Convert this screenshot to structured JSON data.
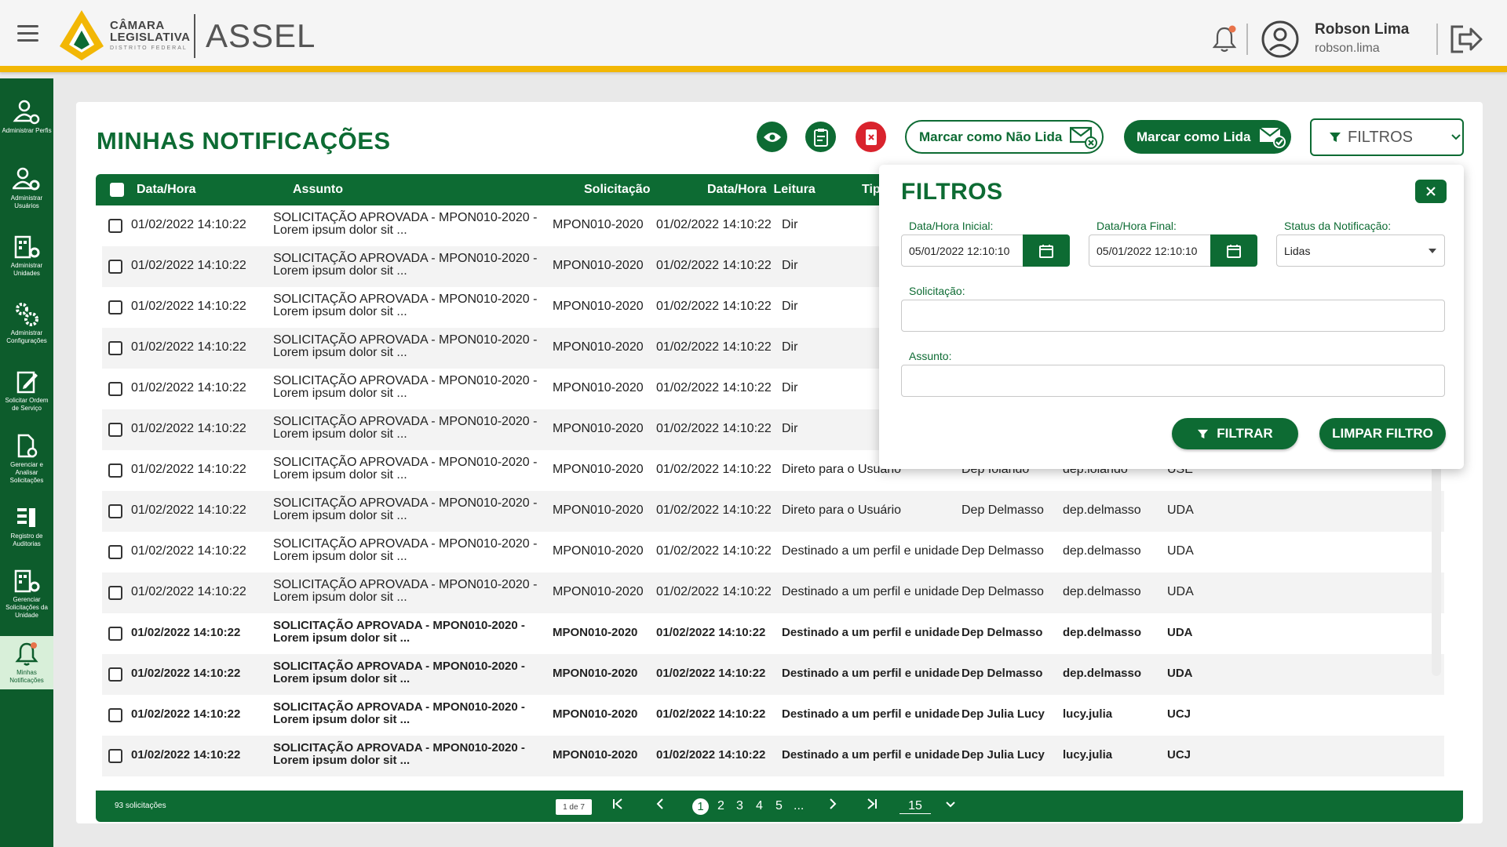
{
  "header": {
    "logo_line1": "CÂMARA",
    "logo_line2": "LEGISLATIVA",
    "logo_line3": "DISTRITO FEDERAL",
    "app_name": "ASSEL",
    "user_name": "Robson Lima",
    "user_login": "robson.lima"
  },
  "sidebar": {
    "items": [
      {
        "label": "Administrar Perfis",
        "icon": "user-gear-icon"
      },
      {
        "label": "Administrar Usuários",
        "icon": "users-gear-icon"
      },
      {
        "label": "Administrar Unidades",
        "icon": "building-gear-icon"
      },
      {
        "label": "Administrar Configurações",
        "icon": "gears-icon"
      },
      {
        "label": "Solicitar Ordem de Serviço",
        "icon": "edit-document-icon"
      },
      {
        "label": "Gerenciar e Analisar Solicitações",
        "icon": "document-view-icon"
      },
      {
        "label": "Registro de Auditorias",
        "icon": "audit-list-icon"
      },
      {
        "label": "Gerenciar Solicitações da Unidade",
        "icon": "building-gear-icon"
      },
      {
        "label": "Minhas Notificações",
        "icon": "bell-icon"
      }
    ]
  },
  "page": {
    "title": "MINHAS NOTIFICAÇÕES",
    "mark_unread": "Marcar como Não Lida",
    "mark_read": "Marcar como Lida",
    "filters_button": "FILTROS"
  },
  "table": {
    "headers": [
      "Data/Hora",
      "Assunto",
      "Solicitação",
      "Data/Hora  Leitura",
      "Tipo"
    ],
    "rows": [
      {
        "dt": "01/02/2022 14:10:22",
        "s1": "SOLICITAÇÃO APROVADA - MPON010-2020 -",
        "s2": "Lorem ipsum dolor sit ...",
        "sol": "MPON010-2020",
        "lt": "01/02/2022 14:10:22",
        "tipo": "Dir",
        "nome": "",
        "login": "",
        "un": ""
      },
      {
        "dt": "01/02/2022 14:10:22",
        "s1": "SOLICITAÇÃO APROVADA - MPON010-2020 -",
        "s2": "Lorem ipsum dolor sit ...",
        "sol": "MPON010-2020",
        "lt": "01/02/2022 14:10:22",
        "tipo": "Dir",
        "nome": "",
        "login": "",
        "un": ""
      },
      {
        "dt": "01/02/2022 14:10:22",
        "s1": "SOLICITAÇÃO APROVADA - MPON010-2020 -",
        "s2": "Lorem ipsum dolor sit ...",
        "sol": "MPON010-2020",
        "lt": "01/02/2022 14:10:22",
        "tipo": "Dir",
        "nome": "",
        "login": "",
        "un": ""
      },
      {
        "dt": "01/02/2022 14:10:22",
        "s1": "SOLICITAÇÃO APROVADA - MPON010-2020 -",
        "s2": "Lorem ipsum dolor sit ...",
        "sol": "MPON010-2020",
        "lt": "01/02/2022 14:10:22",
        "tipo": "Dir",
        "nome": "",
        "login": "",
        "un": ""
      },
      {
        "dt": "01/02/2022 14:10:22",
        "s1": "SOLICITAÇÃO APROVADA - MPON010-2020 -",
        "s2": "Lorem ipsum dolor sit ...",
        "sol": "MPON010-2020",
        "lt": "01/02/2022 14:10:22",
        "tipo": "Dir",
        "nome": "",
        "login": "",
        "un": ""
      },
      {
        "dt": "01/02/2022 14:10:22",
        "s1": "SOLICITAÇÃO APROVADA - MPON010-2020 -",
        "s2": "Lorem ipsum dolor sit ...",
        "sol": "MPON010-2020",
        "lt": "01/02/2022 14:10:22",
        "tipo": "Dir",
        "nome": "",
        "login": "",
        "un": ""
      },
      {
        "dt": "01/02/2022 14:10:22",
        "s1": "SOLICITAÇÃO APROVADA - MPON010-2020 -",
        "s2": "Lorem ipsum dolor sit ...",
        "sol": "MPON010-2020",
        "lt": "01/02/2022 14:10:22",
        "tipo": "Direto para o Usuário",
        "nome": "Dep Iolando",
        "login": "dep.iolando",
        "un": "USE"
      },
      {
        "dt": "01/02/2022 14:10:22",
        "s1": "SOLICITAÇÃO APROVADA - MPON010-2020 -",
        "s2": "Lorem ipsum dolor sit ...",
        "sol": "MPON010-2020",
        "lt": "01/02/2022 14:10:22",
        "tipo": "Direto para o Usuário",
        "nome": "Dep Delmasso",
        "login": "dep.delmasso",
        "un": "UDA"
      },
      {
        "dt": "01/02/2022 14:10:22",
        "s1": "SOLICITAÇÃO APROVADA - MPON010-2020 -",
        "s2": "Lorem ipsum dolor sit ...",
        "sol": "MPON010-2020",
        "lt": "01/02/2022 14:10:22",
        "tipo": "Destinado a um perfil e unidade",
        "nome": "Dep Delmasso",
        "login": "dep.delmasso",
        "un": "UDA"
      },
      {
        "dt": "01/02/2022 14:10:22",
        "s1": "SOLICITAÇÃO APROVADA - MPON010-2020 -",
        "s2": "Lorem ipsum dolor sit ...",
        "sol": "MPON010-2020",
        "lt": "01/02/2022 14:10:22",
        "tipo": "Destinado a um perfil e unidade",
        "nome": "Dep Delmasso",
        "login": "dep.delmasso",
        "un": "UDA"
      },
      {
        "dt": "01/02/2022 14:10:22",
        "s1": "SOLICITAÇÃO APROVADA - MPON010-2020 -",
        "s2": "Lorem ipsum dolor sit ...",
        "sol": "MPON010-2020",
        "lt": "01/02/2022 14:10:22",
        "tipo": "Destinado a um perfil e unidade",
        "nome": "Dep Delmasso",
        "login": "dep.delmasso",
        "un": "UDA"
      },
      {
        "dt": "01/02/2022 14:10:22",
        "s1": "SOLICITAÇÃO APROVADA - MPON010-2020 -",
        "s2": "Lorem ipsum dolor sit ...",
        "sol": "MPON010-2020",
        "lt": "01/02/2022 14:10:22",
        "tipo": "Destinado a um perfil e unidade",
        "nome": "Dep Delmasso",
        "login": "dep.delmasso",
        "un": "UDA"
      },
      {
        "dt": "01/02/2022 14:10:22",
        "s1": "SOLICITAÇÃO APROVADA - MPON010-2020 -",
        "s2": "Lorem ipsum dolor sit ...",
        "sol": "MPON010-2020",
        "lt": "01/02/2022 14:10:22",
        "tipo": "Destinado a um perfil e unidade",
        "nome": "Dep Julia Lucy",
        "login": "lucy.julia",
        "un": "UCJ"
      },
      {
        "dt": "01/02/2022 14:10:22",
        "s1": "SOLICITAÇÃO APROVADA - MPON010-2020 -",
        "s2": "Lorem ipsum dolor sit ...",
        "sol": "MPON010-2020",
        "lt": "01/02/2022 14:10:22",
        "tipo": "Destinado a um perfil e unidade",
        "nome": "Dep Julia Lucy",
        "login": "lucy.julia",
        "un": "UCJ"
      }
    ]
  },
  "footer": {
    "count": "93 solicitações",
    "page_of": "1 de 7",
    "pages": [
      "1",
      "2",
      "3",
      "4",
      "5",
      "..."
    ],
    "per_page": "15"
  },
  "filters": {
    "title": "FILTROS",
    "start_label": "Data/Hora Inicial:",
    "start_value": "05/01/2022 12:10:10",
    "end_label": "Data/Hora Final:",
    "end_value": "05/01/2022 12:10:10",
    "status_label": "Status da Notificação:",
    "status_value": "Lidas",
    "request_label": "Solicitação:",
    "subject_label": "Assunto:",
    "filter_button": "FILTRAR",
    "clear_button": "LIMPAR FILTRO"
  },
  "colors": {
    "primary": "#0d6b33",
    "accent": "#f2b705",
    "danger": "#d9232d"
  }
}
